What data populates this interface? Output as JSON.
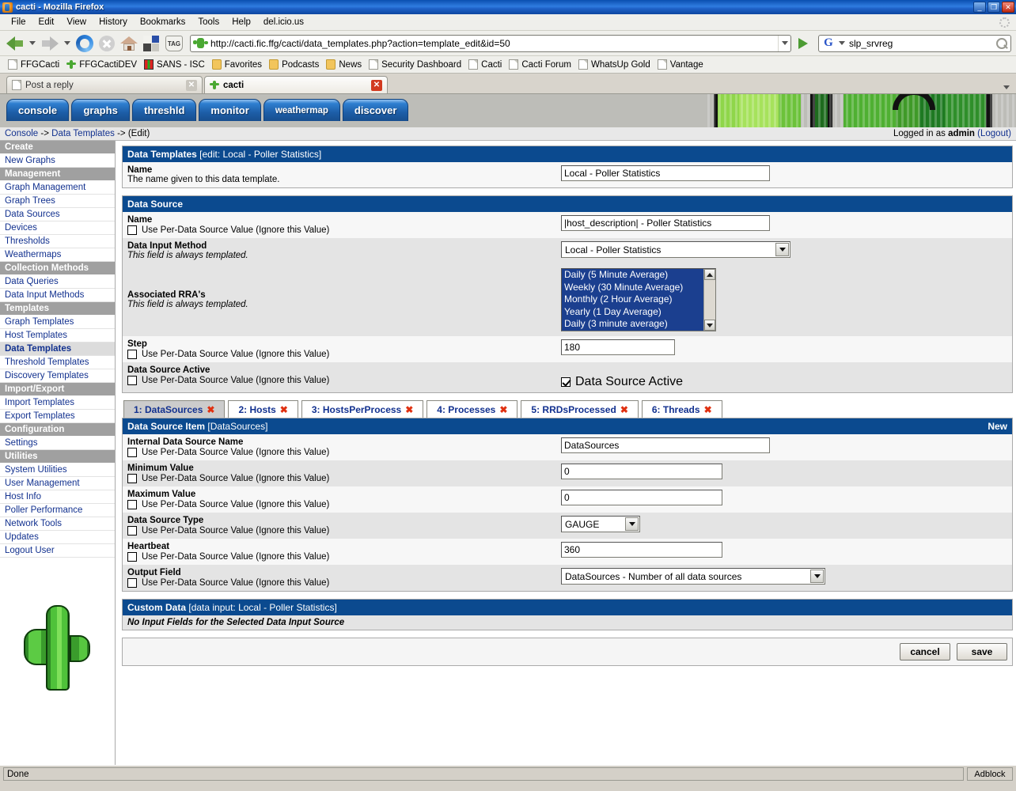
{
  "window": {
    "title": "cacti - Mozilla Firefox",
    "icon": "firefox-icon",
    "minimize": "_",
    "maximize": "❐",
    "close": "✕"
  },
  "menubar": {
    "items": [
      {
        "label": "File"
      },
      {
        "label": "Edit"
      },
      {
        "label": "View"
      },
      {
        "label": "History"
      },
      {
        "label": "Bookmarks"
      },
      {
        "label": "Tools"
      },
      {
        "label": "Help"
      },
      {
        "label": "del.icio.us"
      }
    ]
  },
  "navbar": {
    "back": "back-arrow-icon",
    "forward": "forward-arrow-icon",
    "reload": "reload-icon",
    "stop": "stop-icon",
    "home": "home-icon",
    "tag_label": "TAG",
    "url": "http://cacti.fic.ffg/cacti/data_templates.php?action=template_edit&id=50",
    "url_placeholder": "",
    "go": "go-icon",
    "search_engine": "G",
    "search_value": "slp_srvreg",
    "search_placeholder": ""
  },
  "bookmarks": [
    {
      "label": "FFGCacti",
      "icon": "doc"
    },
    {
      "label": "FFGCactiDEV",
      "icon": "cactus"
    },
    {
      "label": "SANS - ISC",
      "icon": "sans"
    },
    {
      "label": "Favorites",
      "icon": "folder"
    },
    {
      "label": "Podcasts",
      "icon": "folder"
    },
    {
      "label": "News",
      "icon": "folder"
    },
    {
      "label": "Security Dashboard",
      "icon": "doc"
    },
    {
      "label": "Cacti",
      "icon": "doc"
    },
    {
      "label": "Cacti Forum",
      "icon": "doc"
    },
    {
      "label": "WhatsUp Gold",
      "icon": "doc"
    },
    {
      "label": "Vantage",
      "icon": "doc"
    }
  ],
  "browser_tabs": [
    {
      "label": "Post a reply",
      "active": false,
      "icon": "doc"
    },
    {
      "label": "cacti",
      "active": true,
      "icon": "cactus"
    }
  ],
  "cacti_nav": {
    "tabs": [
      {
        "label": "console"
      },
      {
        "label": "graphs"
      },
      {
        "label": "threshld"
      },
      {
        "label": "monitor"
      },
      {
        "label": "weathermap"
      },
      {
        "label": "discover"
      }
    ]
  },
  "breadcrumb": {
    "root": "Console",
    "sep1": "->",
    "section": "Data Templates",
    "sep2": "->",
    "current": "(Edit)",
    "login_prefix": "Logged in as",
    "login_user": "admin",
    "logout": "(Logout)"
  },
  "sidebar": {
    "groups": [
      {
        "header": "Create",
        "items": [
          {
            "label": "New Graphs",
            "current": false
          }
        ]
      },
      {
        "header": "Management",
        "items": [
          {
            "label": "Graph Management",
            "current": false
          },
          {
            "label": "Graph Trees",
            "current": false
          },
          {
            "label": "Data Sources",
            "current": false
          },
          {
            "label": "Devices",
            "current": false
          },
          {
            "label": "Thresholds",
            "current": false
          },
          {
            "label": "Weathermaps",
            "current": false
          }
        ]
      },
      {
        "header": "Collection Methods",
        "items": [
          {
            "label": "Data Queries",
            "current": false
          },
          {
            "label": "Data Input Methods",
            "current": false
          }
        ]
      },
      {
        "header": "Templates",
        "items": [
          {
            "label": "Graph Templates",
            "current": false
          },
          {
            "label": "Host Templates",
            "current": false
          },
          {
            "label": "Data Templates",
            "current": true
          },
          {
            "label": "Threshold Templates",
            "current": false
          },
          {
            "label": "Discovery Templates",
            "current": false
          }
        ]
      },
      {
        "header": "Import/Export",
        "items": [
          {
            "label": "Import Templates",
            "current": false
          },
          {
            "label": "Export Templates",
            "current": false
          }
        ]
      },
      {
        "header": "Configuration",
        "items": [
          {
            "label": "Settings",
            "current": false
          }
        ]
      },
      {
        "header": "Utilities",
        "items": [
          {
            "label": "System Utilities",
            "current": false
          },
          {
            "label": "User Management",
            "current": false
          },
          {
            "label": "Host Info",
            "current": false
          },
          {
            "label": "Poller Performance",
            "current": false
          },
          {
            "label": "Network Tools",
            "current": false
          },
          {
            "label": "Updates",
            "current": false
          },
          {
            "label": "Logout User",
            "current": false
          }
        ]
      }
    ]
  },
  "panels": {
    "data_templates": {
      "title": "Data Templates",
      "subtitle": "[edit: Local - Poller Statistics]",
      "name_label": "Name",
      "name_desc": "The name given to this data template.",
      "name_value": "Local - Poller Statistics"
    },
    "data_source": {
      "title": "Data Source",
      "rows": [
        {
          "label": "Name",
          "checkbox": "Use Per-Data Source Value (Ignore this Value)",
          "value": "|host_description| - Poller Statistics"
        },
        {
          "label": "Data Input Method",
          "desc": "This field is always templated.",
          "value": "Local - Poller Statistics"
        },
        {
          "label": "Associated RRA's",
          "desc": "This field is always templated.",
          "options": [
            "Daily (5 Minute Average)",
            "Weekly (30 Minute Average)",
            "Monthly (2 Hour Average)",
            "Yearly (1 Day Average)",
            "Daily (3 minute average)"
          ]
        },
        {
          "label": "Step",
          "checkbox": "Use Per-Data Source Value (Ignore this Value)",
          "value": "180"
        },
        {
          "label": "Data Source Active",
          "checkbox": "Use Per-Data Source Value (Ignore this Value)",
          "active_label": "Data Source Active",
          "active_checked": true
        }
      ]
    },
    "data_source_item": {
      "tabs": [
        {
          "label": "1: DataSources",
          "close": "✖",
          "active": true
        },
        {
          "label": "2: Hosts",
          "close": "✖",
          "active": false
        },
        {
          "label": "3: HostsPerProcess",
          "close": "✖",
          "active": false
        },
        {
          "label": "4: Processes",
          "close": "✖",
          "active": false
        },
        {
          "label": "5: RRDsProcessed",
          "close": "✖",
          "active": false
        },
        {
          "label": "6: Threads",
          "close": "✖",
          "active": false
        }
      ],
      "title": "Data Source Item",
      "subtitle": "[DataSources]",
      "new_link": "New",
      "rows": [
        {
          "label": "Internal Data Source Name",
          "checkbox": "Use Per-Data Source Value (Ignore this Value)",
          "value": "DataSources",
          "type": "text"
        },
        {
          "label": "Minimum Value",
          "checkbox": "Use Per-Data Source Value (Ignore this Value)",
          "value": "0",
          "type": "text"
        },
        {
          "label": "Maximum Value",
          "checkbox": "Use Per-Data Source Value (Ignore this Value)",
          "value": "0",
          "type": "text"
        },
        {
          "label": "Data Source Type",
          "checkbox": "Use Per-Data Source Value (Ignore this Value)",
          "value": "GAUGE",
          "type": "select"
        },
        {
          "label": "Heartbeat",
          "checkbox": "Use Per-Data Source Value (Ignore this Value)",
          "value": "360",
          "type": "text"
        },
        {
          "label": "Output Field",
          "checkbox": "Use Per-Data Source Value (Ignore this Value)",
          "value": "DataSources - Number of all data sources",
          "type": "select-wide"
        }
      ]
    },
    "custom_data": {
      "title": "Custom Data",
      "subtitle": "[data input: Local - Poller Statistics]",
      "empty_text": "No Input Fields for the Selected Data Input Source"
    }
  },
  "actions": {
    "cancel": "cancel",
    "save": "save"
  },
  "statusbar": {
    "status": "Done",
    "adblock": "Adblock"
  },
  "colors": {
    "panel_header": "#0b4a8f",
    "sidebar_header": "#a0a0a0",
    "link": "#12318f",
    "listbox_selected": "#1b3f8f",
    "close_x": "#e03010"
  }
}
